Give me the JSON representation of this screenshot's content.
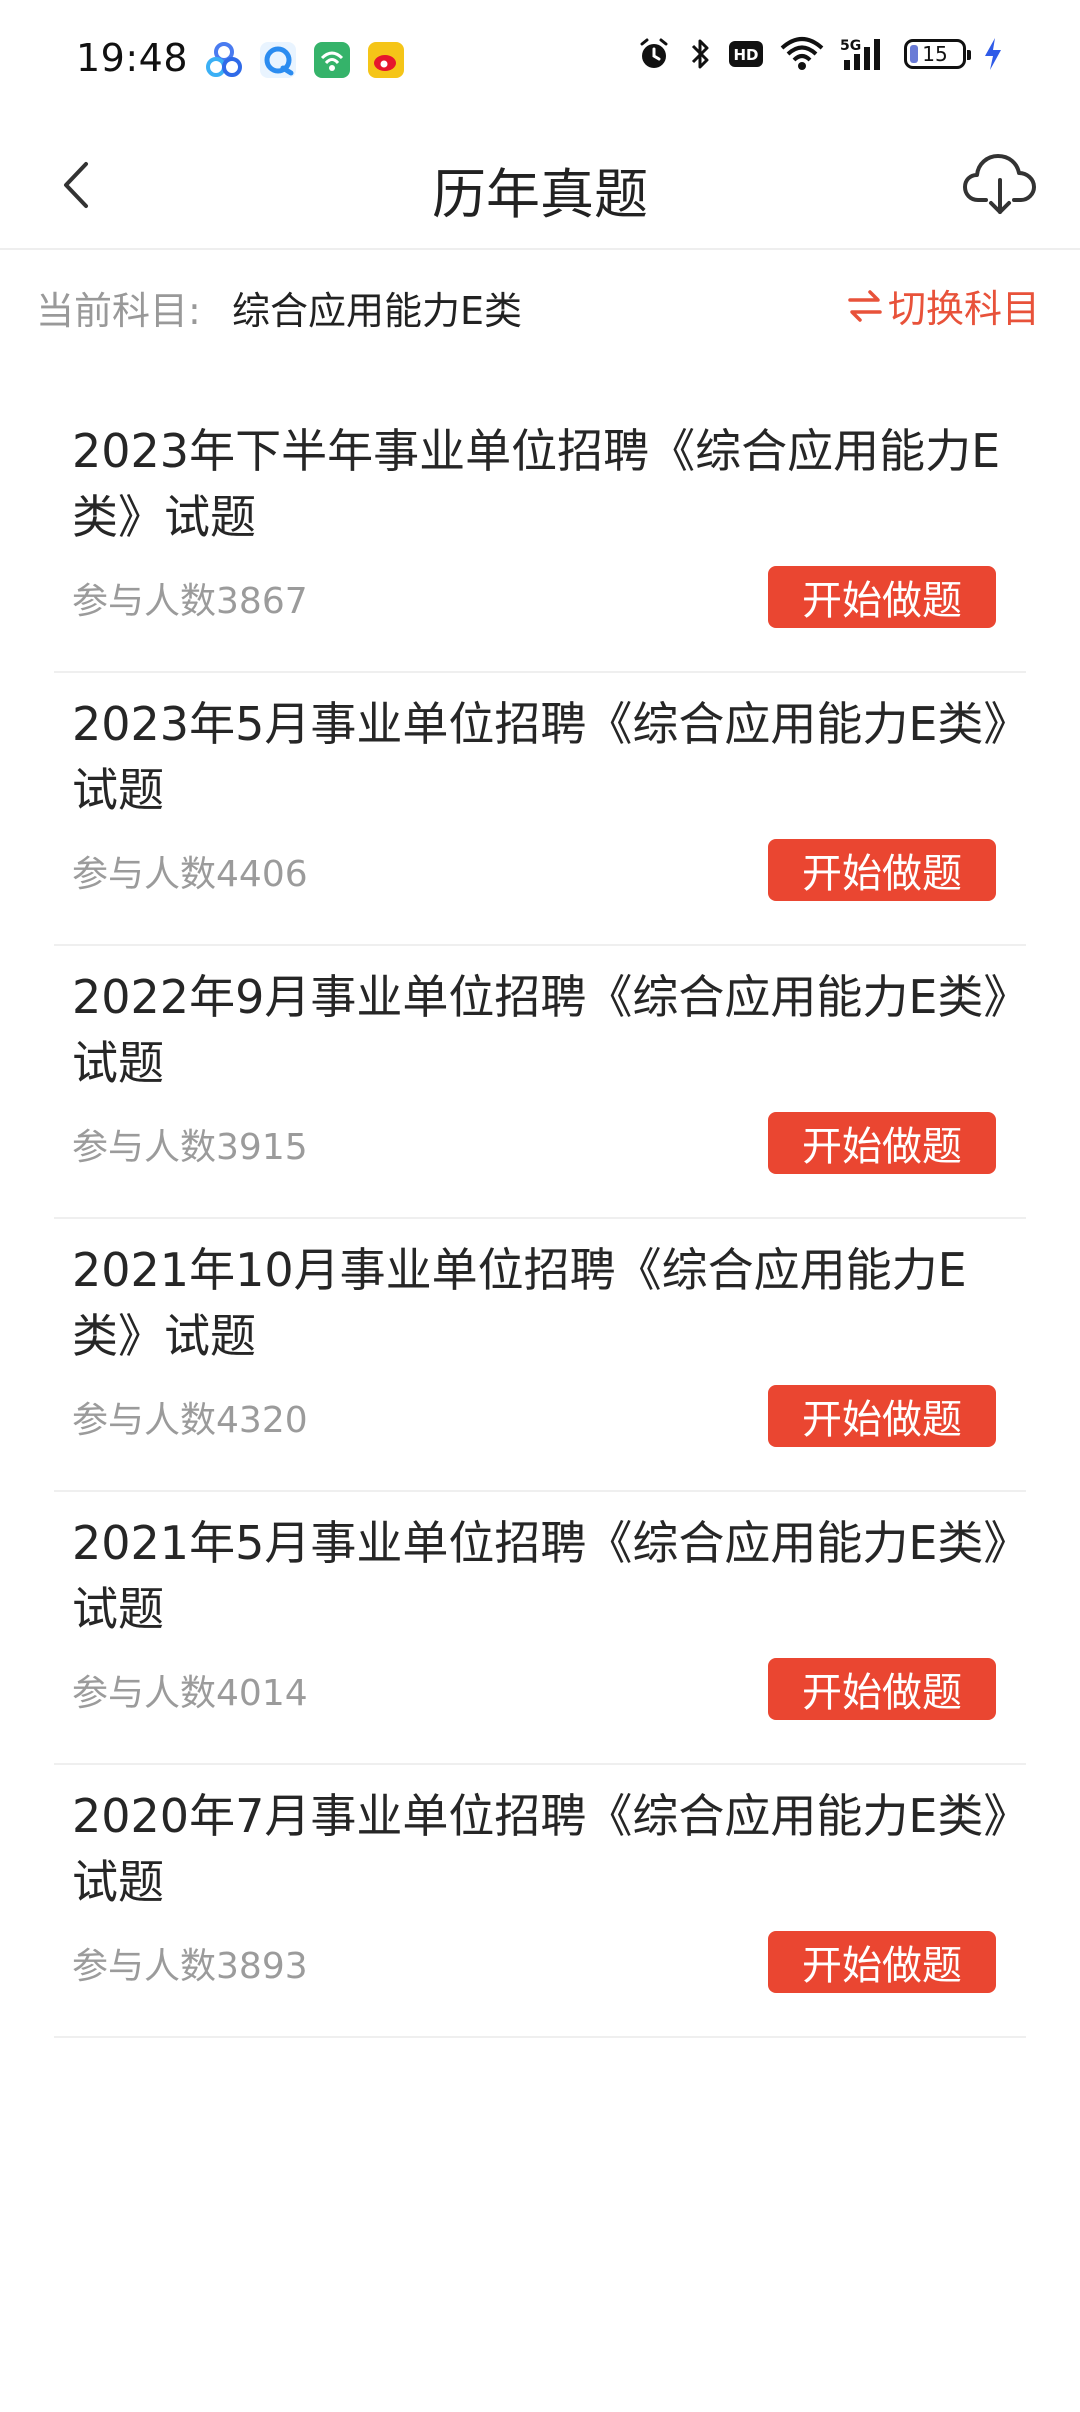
{
  "status_bar": {
    "time": "19:48",
    "battery_level": "15",
    "icons": [
      "baidu-app-icon",
      "browser-app-icon",
      "wifi-app-icon",
      "weibo-app-icon",
      "alarm-icon",
      "bluetooth-icon",
      "hd-icon",
      "wifi-icon",
      "signal-5g-icon",
      "battery-icon",
      "charging-icon"
    ]
  },
  "header": {
    "title": "历年真题",
    "back_icon": "chevron-left-icon",
    "download_icon": "cloud-download-icon"
  },
  "subject": {
    "label": "当前科目:",
    "value": "综合应用能力E类",
    "switch_label": "切换科目",
    "switch_icon": "swap-arrows-icon"
  },
  "exams": [
    {
      "title": "2023年下半年事业单位招聘《综合应用能力E类》试题",
      "count_label": "参与人数",
      "count": "3867",
      "button": "开始做题"
    },
    {
      "title": "2023年5月事业单位招聘《综合应用能力E类》试题",
      "count_label": "参与人数",
      "count": "4406",
      "button": "开始做题"
    },
    {
      "title": "2022年9月事业单位招聘《综合应用能力E类》试题",
      "count_label": "参与人数",
      "count": "3915",
      "button": "开始做题"
    },
    {
      "title": "2021年10月事业单位招聘《综合应用能力E类》试题",
      "count_label": "参与人数",
      "count": "4320",
      "button": "开始做题"
    },
    {
      "title": "2021年5月事业单位招聘《综合应用能力E类》试题",
      "count_label": "参与人数",
      "count": "4014",
      "button": "开始做题"
    },
    {
      "title": "2020年7月事业单位招聘《综合应用能力E类》试题",
      "count_label": "参与人数",
      "count": "3893",
      "button": "开始做题"
    }
  ],
  "colors": {
    "accent": "#ea4631",
    "switch_text": "#e8523a",
    "muted_text": "#9b9b9b",
    "primary_text": "#262626"
  }
}
